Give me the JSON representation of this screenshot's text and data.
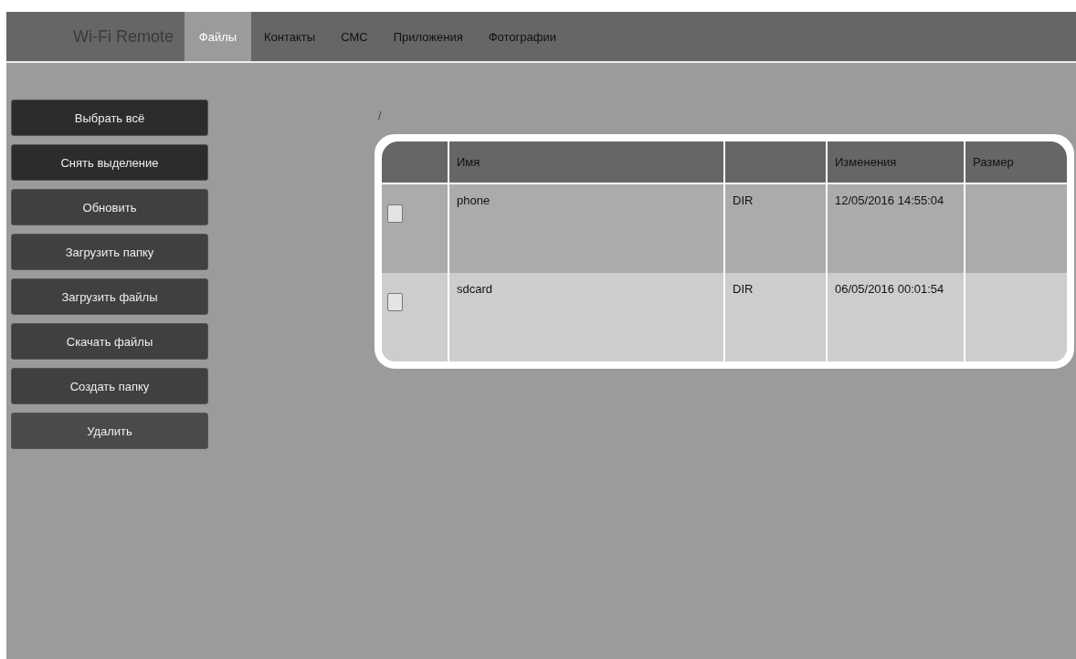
{
  "navbar": {
    "brand": "Wi-Fi Remote",
    "tabs": [
      {
        "label": "Файлы",
        "selected": true
      },
      {
        "label": "Контакты",
        "selected": false
      },
      {
        "label": "СМС",
        "selected": false
      },
      {
        "label": "Приложения",
        "selected": false
      },
      {
        "label": "Фотографии",
        "selected": false
      }
    ]
  },
  "actions": [
    {
      "label": "Выбрать всё",
      "kind": "dark"
    },
    {
      "label": "Снять выделение",
      "kind": "dark"
    },
    {
      "label": "Обновить",
      "kind": "normal"
    },
    {
      "label": "Загрузить папку",
      "kind": "normal"
    },
    {
      "label": "Загрузить файлы",
      "kind": "normal"
    },
    {
      "label": "Скачать файлы",
      "kind": "normal"
    },
    {
      "label": "Создать папку",
      "kind": "normal"
    },
    {
      "label": "Удалить",
      "kind": "light"
    }
  ],
  "path": "/",
  "table": {
    "columns": [
      "Имя",
      "Изменения",
      "Размер"
    ],
    "rows": [
      {
        "checked": false,
        "name": "phone",
        "type": "DIR",
        "modified": "12/05/2016 14:55:04"
      },
      {
        "checked": false,
        "name": "sdcard",
        "type": "DIR",
        "modified": "06/05/2016 00:01:54"
      }
    ]
  }
}
